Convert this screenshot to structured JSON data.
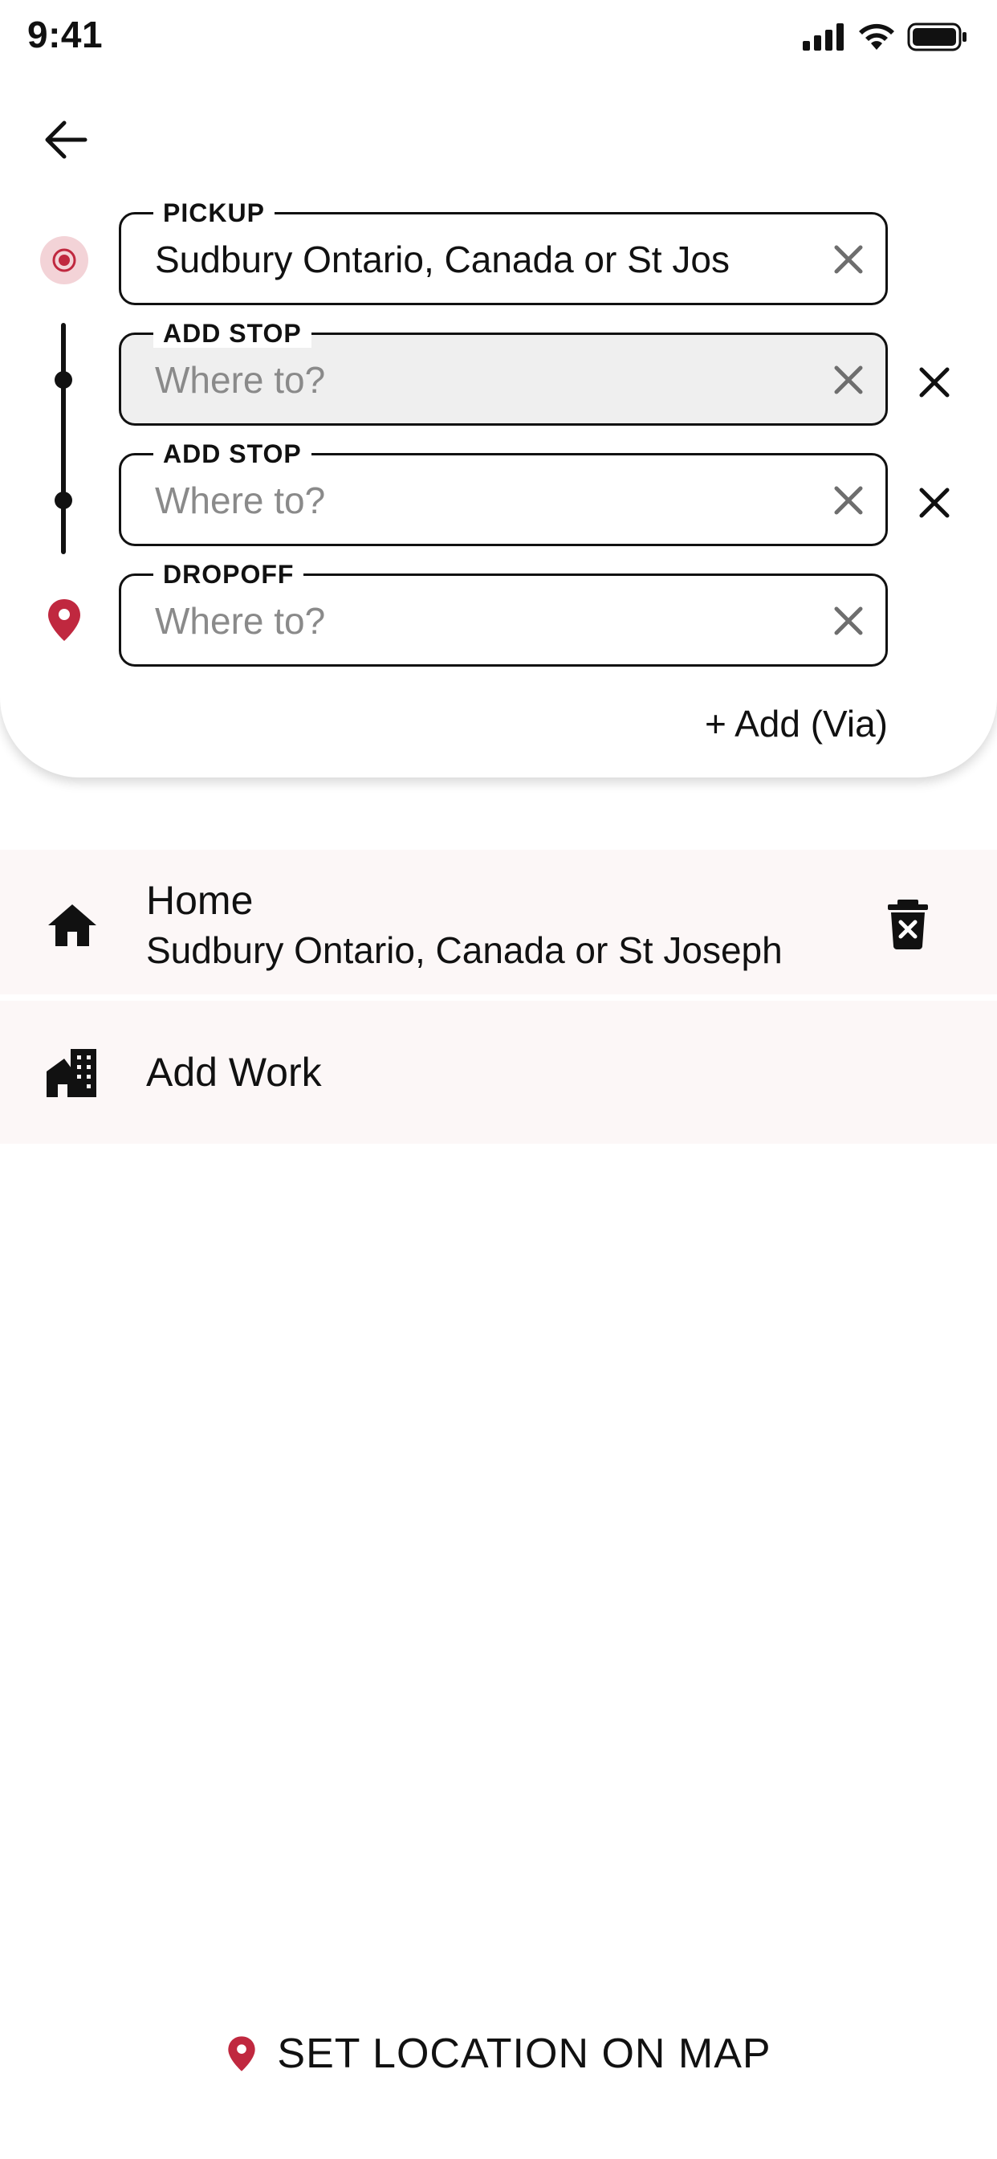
{
  "status_bar": {
    "time": "9:41"
  },
  "colors": {
    "accent": "#c0283f",
    "accent_soft": "#f3d3d7",
    "row_bg": "#fcf7f7",
    "shaded_field": "#efefef"
  },
  "header": {
    "back_icon": "arrow-left-icon"
  },
  "fields": {
    "pickup": {
      "label": "PICKUP",
      "value": "Sudbury Ontario, Canada or St Jos",
      "placeholder": ""
    },
    "stop_1": {
      "label": "ADD STOP",
      "value": "",
      "placeholder": "Where to?"
    },
    "stop_2": {
      "label": "ADD STOP",
      "value": "",
      "placeholder": "Where to?"
    },
    "dropoff": {
      "label": "DROPOFF",
      "value": "",
      "placeholder": "Where to?"
    }
  },
  "add_via_label": "+ Add (Via)",
  "saved_places": {
    "home": {
      "title": "Home",
      "address": "Sudbury Ontario, Canada or St Joseph",
      "icon": "home-icon",
      "action_icon": "delete-icon"
    },
    "work": {
      "title": "Add Work",
      "icon": "building-icon"
    }
  },
  "set_location_label": "SET LOCATION ON MAP"
}
